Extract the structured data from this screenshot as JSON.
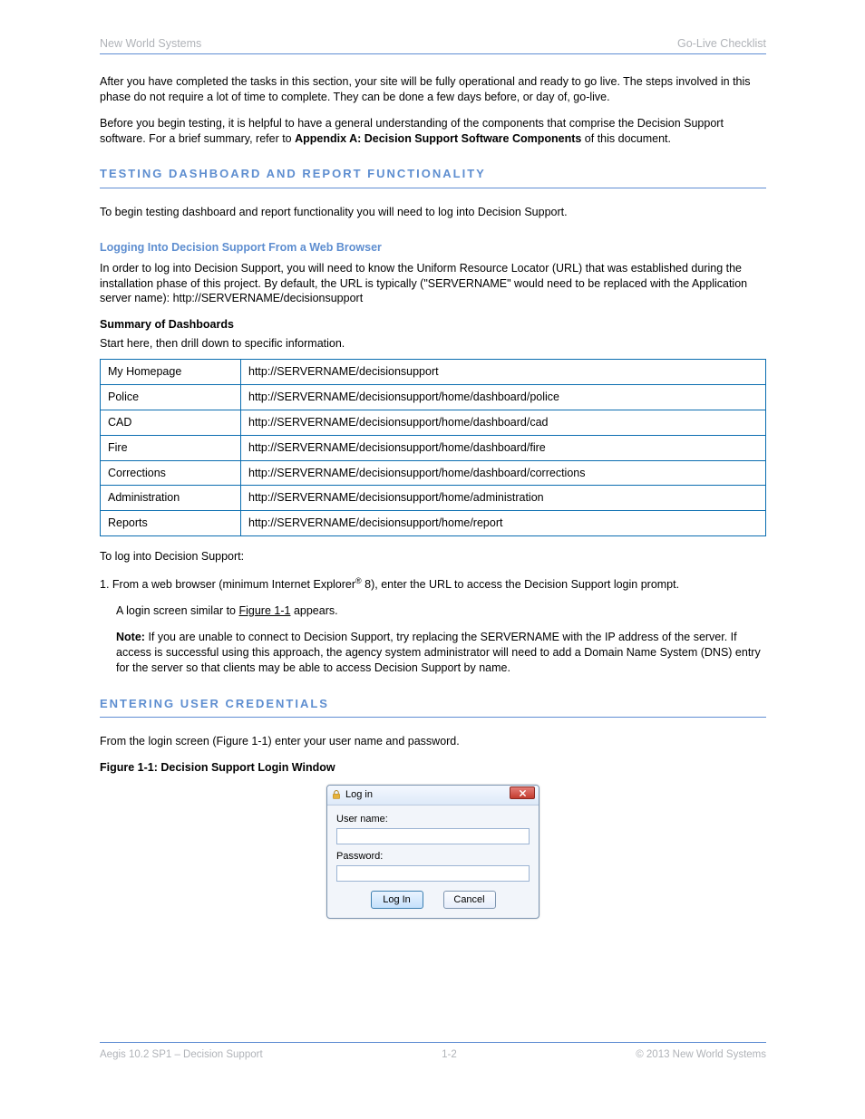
{
  "header": {
    "left": "New World Systems",
    "right": "Go-Live Checklist"
  },
  "intro_para1": "After you have completed the tasks in this section, your site will be fully operational and ready to go live. The steps involved in this phase do not require a lot of time to complete. They can be done a few days before, or day of, go-live.",
  "intro_para2_prefix": "Before you begin testing, it is helpful to have a general understanding of the components that comprise the Decision Support software. For a brief summary, refer to ",
  "intro_para2_link": "Appendix A: Decision Support Software Components",
  "intro_para2_suffix": " of this document.",
  "s1": {
    "title": "TESTING DASHBOARD AND REPORT FUNCTIONALITY",
    "para": "To begin testing dashboard and report functionality you will need to log into Decision Support."
  },
  "s1a": {
    "title": "Logging Into Decision Support From a Web Browser",
    "para1": "In order to log into Decision Support, you will need to know the Uniform Resource Locator (URL) that was established during the installation phase of this project. By default, the URL is typically (\"SERVERNAME\" would need to be replaced with the Application server name): http://SERVERNAME/decisionsupport",
    "summary_title": "Summary of Dashboards",
    "summary_intro": "Start here, then drill down to specific information.",
    "table": [
      [
        "My Homepage",
        "http://SERVERNAME/decisionsupport"
      ],
      [
        "Police",
        "http://SERVERNAME/decisionsupport/home/dashboard/police"
      ],
      [
        "CAD",
        "http://SERVERNAME/decisionsupport/home/dashboard/cad"
      ],
      [
        "Fire",
        "http://SERVERNAME/decisionsupport/home/dashboard/fire"
      ],
      [
        "Corrections",
        "http://SERVERNAME/decisionsupport/home/dashboard/corrections"
      ],
      [
        "Administration",
        "http://SERVERNAME/decisionsupport/home/administration"
      ],
      [
        "Reports",
        "http://SERVERNAME/decisionsupport/home/report"
      ]
    ],
    "steps_intro": "To log into Decision Support:",
    "step1_pre": "1.  From a web browser (minimum Internet Explorer",
    "step1_reg": "®",
    "step1_post": " 8), enter the URL to access the Decision Support login prompt.",
    "step2_pre": "A login screen similar to ",
    "step2_link": "Figure 1-1",
    "step2_post": " appears.",
    "note_pre": "Note:",
    "note_body": "If you are unable to connect to Decision Support, try replacing the SERVERNAME with the IP address of the server. If access is successful using this approach, the agency system administrator will need to add a Domain Name System (DNS) entry for the server so that clients may be able to access Decision Support by name."
  },
  "s1b": {
    "title": "Entering User Credentials",
    "para1_pre": "From the login screen (",
    "para1_link": "Figure 1-1",
    "para1_post": ") enter your user name and password.",
    "figure_caption": "Figure 1-1: Decision Support Login Window"
  },
  "login": {
    "title": "Log in",
    "username_label": "User name:",
    "password_label": "Password:",
    "login_btn": "Log In",
    "cancel_btn": "Cancel"
  },
  "footer": {
    "left": "Aegis 10.2 SP1 – Decision Support",
    "page": "1-2",
    "right": "© 2013 New World Systems"
  }
}
